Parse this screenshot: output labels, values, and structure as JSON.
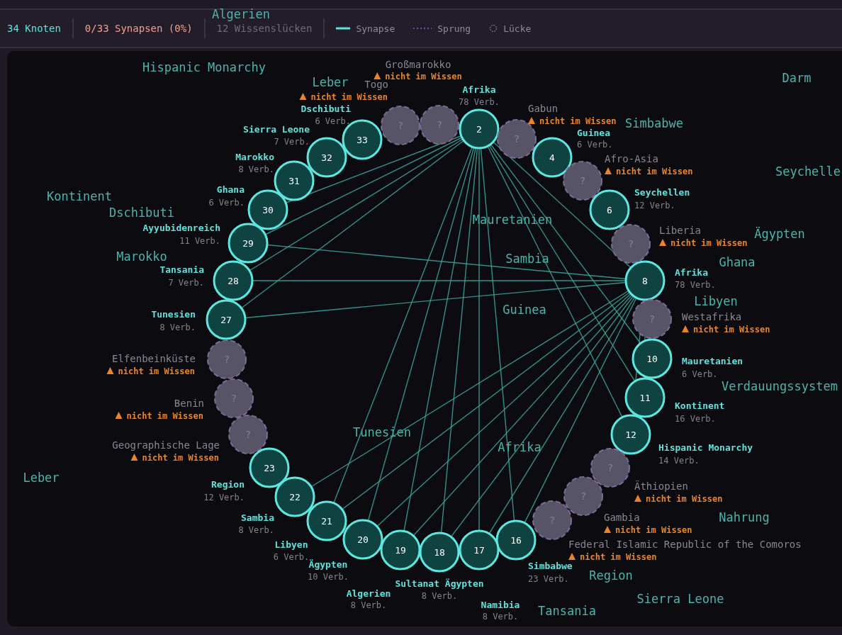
{
  "stats": {
    "nodes": "34 Knoten",
    "synapses": "0/33 Synapsen (0%)",
    "gaps": "12 Wissenslücken"
  },
  "legend": [
    {
      "kind": "synapse",
      "label": "Synapse"
    },
    {
      "kind": "jump",
      "label": "Sprung"
    },
    {
      "kind": "gap",
      "label": "Lücke"
    }
  ],
  "nodes_right": [
    {
      "kind": "gap",
      "label": "Großmarokko",
      "symbol": "?",
      "warning": "nicht im Wissen"
    },
    {
      "kind": "known",
      "number": "2",
      "label": "Afrika",
      "degree": "78 Verb."
    },
    {
      "kind": "gap",
      "label": "Gabun",
      "symbol": "?",
      "warning": "nicht im Wissen"
    },
    {
      "kind": "known",
      "number": "4",
      "label": "Guinea",
      "degree": "6 Verb."
    },
    {
      "kind": "gap",
      "label": "Afro-Asia",
      "symbol": "?",
      "warning": "nicht im Wissen"
    },
    {
      "kind": "known",
      "number": "6",
      "label": "Seychellen",
      "degree": "12 Verb."
    },
    {
      "kind": "gap",
      "label": "Liberia",
      "symbol": "?",
      "warning": "nicht im Wissen"
    },
    {
      "kind": "known",
      "number": "8",
      "label": "Afrika",
      "degree": "78 Verb."
    },
    {
      "kind": "gap",
      "label": "Westafrika",
      "symbol": "?",
      "warning": "nicht im Wissen"
    },
    {
      "kind": "known",
      "number": "10",
      "label": "Mauretanien",
      "degree": "6 Verb."
    },
    {
      "kind": "known",
      "number": "11",
      "label": "Kontinent",
      "degree": "16 Verb."
    },
    {
      "kind": "known",
      "number": "12",
      "label": "Hispanic Monarchy",
      "degree": "14 Verb."
    },
    {
      "kind": "gap",
      "label": "Äthiopien",
      "symbol": "?",
      "warning": "nicht im Wissen"
    },
    {
      "kind": "gap",
      "label": "Gambia",
      "symbol": "?",
      "warning": "nicht im Wissen"
    },
    {
      "kind": "gap",
      "label": "Federal Islamic Republic of the Comoros",
      "symbol": "?",
      "warning": "nicht im Wissen"
    },
    {
      "kind": "known",
      "number": "16",
      "label": "Simbabwe",
      "degree": "23 Verb."
    },
    {
      "kind": "known",
      "number": "17",
      "label": "Namibia",
      "degree": "8 Verb."
    },
    {
      "kind": "known",
      "number": "18",
      "label": "Sultanat Ägypten",
      "degree": "8 Verb."
    }
  ],
  "nodes_left": [
    {
      "kind": "gap",
      "label": "Togo",
      "symbol": "?",
      "warning": "nicht im Wissen"
    },
    {
      "kind": "known",
      "number": "33",
      "label": "Dschibuti",
      "degree": "6 Verb."
    },
    {
      "kind": "known",
      "number": "32",
      "label": "Sierra Leone",
      "degree": "7 Verb."
    },
    {
      "kind": "known",
      "number": "31",
      "label": "Marokko",
      "degree": "8 Verb."
    },
    {
      "kind": "known",
      "number": "30",
      "label": "Ghana",
      "degree": "6 Verb."
    },
    {
      "kind": "known",
      "number": "29",
      "label": "Ayyubidenreich",
      "degree": "11 Verb."
    },
    {
      "kind": "known",
      "number": "28",
      "label": "Tansania",
      "degree": "7 Verb."
    },
    {
      "kind": "known",
      "number": "27",
      "label": "Tunesien",
      "degree": "8 Verb."
    },
    {
      "kind": "gap",
      "label": "Elfenbeinküste",
      "symbol": "?",
      "warning": "nicht im Wissen"
    },
    {
      "kind": "gap",
      "label": "Benin",
      "symbol": "?",
      "warning": "nicht im Wissen"
    },
    {
      "kind": "gap",
      "label": "Geographische Lage",
      "symbol": "?",
      "warning": "nicht im Wissen"
    },
    {
      "kind": "known",
      "number": "23",
      "label": "Region",
      "degree": "12 Verb."
    },
    {
      "kind": "known",
      "number": "22",
      "label": "Sambia",
      "degree": "8 Verb."
    },
    {
      "kind": "known",
      "number": "21",
      "label": "Libyen",
      "degree": "6 Verb."
    },
    {
      "kind": "known",
      "number": "20",
      "label": "Ägypten",
      "degree": "10 Verb."
    },
    {
      "kind": "known",
      "number": "19",
      "label": "Algerien",
      "degree": "8 Verb."
    }
  ],
  "floating_terms": [
    "Algerien",
    "Hispanic Monarchy",
    "Leber",
    "Darm",
    "Simbabwe",
    "Seychelle",
    "Kontinent",
    "Mauretanien",
    "Dschibuti",
    "Ägypten",
    "Ghana",
    "Marokko",
    "Sambia",
    "Libyen",
    "Guinea",
    "Verdauungssystem",
    "Tunesien",
    "Afrika",
    "Leber",
    "Nahrung",
    "Sierra Leone",
    "Region",
    "Tansania"
  ]
}
